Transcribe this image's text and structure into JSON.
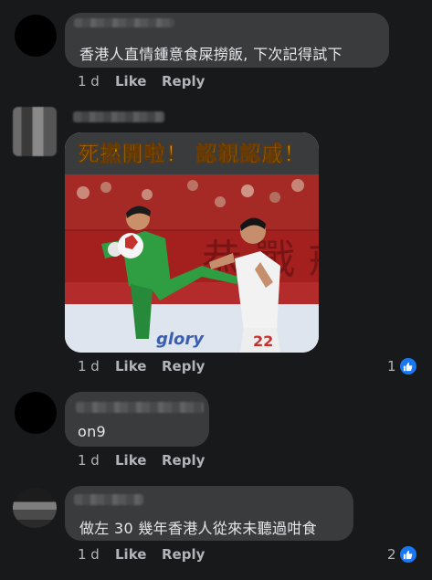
{
  "comments": [
    {
      "text": "香港人直情鍾意食屎撈飯, 下次記得試下",
      "time": "1 d",
      "like_label": "Like",
      "reply_label": "Reply"
    },
    {
      "image_caption": "死撚開啦！ 認親認戚！",
      "image_shirt_number": "22",
      "image_banner_text": "glory",
      "time": "1 d",
      "like_label": "Like",
      "reply_label": "Reply",
      "reaction_count": "1"
    },
    {
      "text": "on9",
      "time": "1 d",
      "like_label": "Like",
      "reply_label": "Reply"
    },
    {
      "text": "做左 30 幾年香港人從來未聽過咁食",
      "time": "1 d",
      "like_label": "Like",
      "reply_label": "Reply",
      "reaction_count": "2"
    }
  ],
  "colors": {
    "background": "#18191a",
    "bubble": "#3a3b3c",
    "text": "#e4e6eb",
    "secondary_text": "#b0b3b8",
    "like_blue": "#1877f2",
    "caption_yellow": "#f3c400"
  },
  "icons": {
    "reaction": "like-thumb-icon"
  }
}
